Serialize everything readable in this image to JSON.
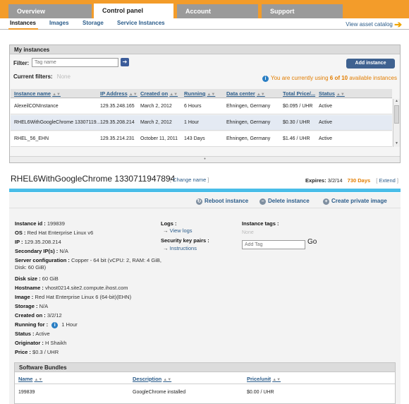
{
  "top_tabs": [
    "Overview",
    "Control panel",
    "Account",
    "Support"
  ],
  "sub_nav": {
    "items": [
      "Instances",
      "Images",
      "Storage",
      "Service Instances"
    ],
    "catalog_link": "View asset catalog"
  },
  "colors": {
    "accent_orange": "#f39c2a",
    "link_blue": "#2b5c8a",
    "banner_blue": "#49bde8"
  },
  "my_instances": {
    "title": "My instances",
    "filter_label": "Filter:",
    "filter_placeholder": "Tag name",
    "current_filters_label": "Current filters:",
    "current_filters_value": "None",
    "add_button": "Add instance",
    "usage_prefix": "You are currently using",
    "usage_count": "6 of 10",
    "usage_suffix": "available instances",
    "columns": [
      "Instance name",
      "IP Address",
      "Created on",
      "Running",
      "Data center",
      "Total Price/...",
      "Status"
    ],
    "rows": [
      [
        "AlexeilCONInstance",
        "129.35.248.165",
        "March 2, 2012",
        "6 Hours",
        "Ehningen, Germany",
        "$0.095 / UHR",
        "Active"
      ],
      [
        "RHEL6WithGoogleChrome 13307119...",
        "129.35.208.214",
        "March 2, 2012",
        "1 Hour",
        "Ehningen, Germany",
        "$0.30 / UHR",
        "Active"
      ],
      [
        "RHEL_56_EHN",
        "129.35.214.231",
        "October 11, 2011",
        "143 Days",
        "Ehningen, Germany",
        "$1.46 / UHR",
        "Active"
      ]
    ]
  },
  "instance": {
    "title": "RHEL6WithGoogleChrome 1330711947894",
    "change_name": "Change name",
    "expires_label": "Expires:",
    "expires_date": "3/2/14",
    "expires_days": "730 Days",
    "extend": "Extend",
    "actions": [
      "Reboot instance",
      "Delete instance",
      "Create private image"
    ],
    "details": [
      {
        "label": "Instance id :",
        "value": "199839"
      },
      {
        "label": "OS :",
        "value": "Red Hat Enterprise Linux v6"
      },
      {
        "label": "IP :",
        "value": "129.35.208.214"
      },
      {
        "label": "Secondary IP(s) :",
        "value": "N/A"
      },
      {
        "label": "Server configuration :",
        "value": "Copper - 64 bit (vCPU: 2, RAM: 4 GiB, Disk: 60 GiB)"
      },
      {
        "label": "Disk size :",
        "value": "60 GiB"
      },
      {
        "label": "Hostname :",
        "value": "vhost0214.site2.compute.ihost.com"
      },
      {
        "label": "Image :",
        "value": "Red Hat Enterprise Linux 6 (64-bit)(EHN)"
      },
      {
        "label": "Storage :",
        "value": "N/A"
      },
      {
        "label": "Created on :",
        "value": "3/2/12"
      },
      {
        "label": "Running for :",
        "value": "1 Hour"
      },
      {
        "label": "Status :",
        "value": "Active"
      },
      {
        "label": "Originator :",
        "value": "H Shaikh"
      },
      {
        "label": "Price :",
        "value": "$0.3 / UHR"
      }
    ],
    "logs_label": "Logs :",
    "view_logs": "View logs",
    "security_label": "Security key pairs :",
    "instructions": "Instructions",
    "tags_label": "Instance tags :",
    "tags_value": "None",
    "tag_placeholder": "Add Tag",
    "go_label": "Go"
  },
  "software_bundles": {
    "title": "Software Bundles",
    "columns": [
      "Name",
      "Description",
      "Price/unit"
    ],
    "rows": [
      [
        "199839",
        "GoogleChrome installed",
        "$0.00 / UHR"
      ]
    ]
  }
}
